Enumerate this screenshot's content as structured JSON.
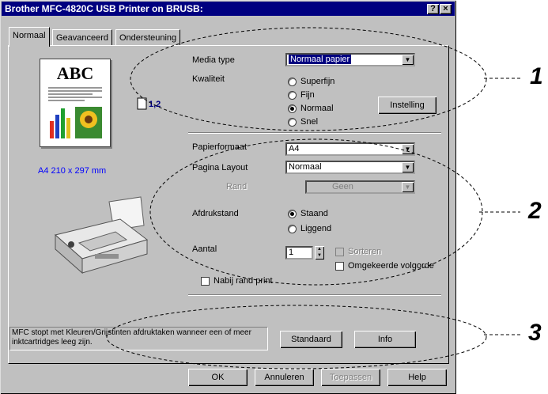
{
  "window": {
    "title": "Brother MFC-4820C USB Printer on BRUSB:",
    "help_btn": "?",
    "close_btn": "×"
  },
  "tabs": [
    {
      "label": "Normaal"
    },
    {
      "label": "Geavanceerd"
    },
    {
      "label": "Ondersteuning"
    }
  ],
  "preview": {
    "doc_text": "ABC",
    "copies_label": "1,2",
    "paper_size": "A4 210 x 297 mm"
  },
  "media": {
    "label": "Media type",
    "value": "Normaal papier"
  },
  "quality": {
    "label": "Kwaliteit",
    "options": [
      {
        "label": "Superfijn",
        "selected": false
      },
      {
        "label": "Fijn",
        "selected": false
      },
      {
        "label": "Normaal",
        "selected": true
      },
      {
        "label": "Snel",
        "selected": false
      }
    ],
    "settings_button": "Instelling"
  },
  "paper": {
    "label": "Papierformaat",
    "value": "A4"
  },
  "layout": {
    "label": "Pagina Layout",
    "value": "Normaal",
    "border_label": "Rand",
    "border_value": "Geen"
  },
  "orientation": {
    "label": "Afdrukstand",
    "options": [
      {
        "label": "Staand",
        "selected": true
      },
      {
        "label": "Liggend",
        "selected": false
      }
    ]
  },
  "copies": {
    "label": "Aantal",
    "value": "1",
    "collate_label": "Sorteren",
    "reverse_label": "Omgekeerde volgorde"
  },
  "near_edge": {
    "label": "Nabij rand print"
  },
  "status_message": "MFC stopt met Kleuren/Grijstinten afdruktaken wanneer een of meer inktcartridges leeg zijn.",
  "buttons": {
    "default": "Standaard",
    "info": "Info",
    "ok": "OK",
    "cancel": "Annuleren",
    "apply": "Toepassen",
    "help": "Help"
  },
  "callouts": [
    "1",
    "2",
    "3"
  ]
}
